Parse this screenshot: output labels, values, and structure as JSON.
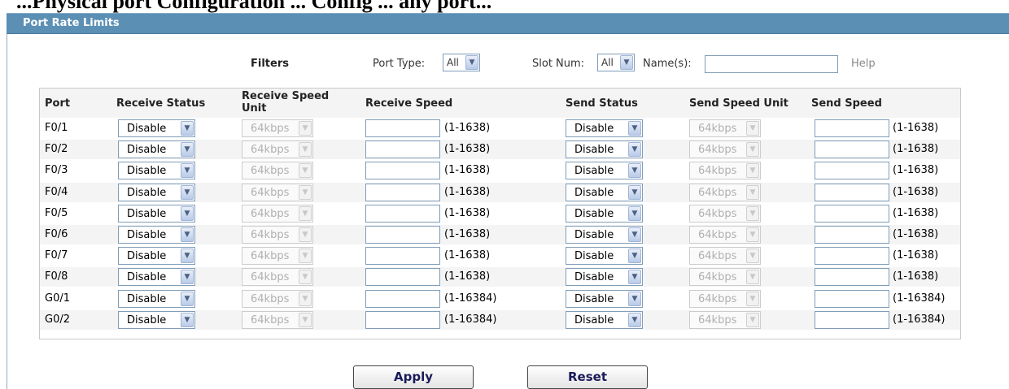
{
  "doc_heading": "...Physical port Configuration ... Config ... any port...",
  "panel_title": "Port Rate Limits",
  "filters": {
    "label": "Filters",
    "port_type_label": "Port Type:",
    "port_type_value": "All",
    "slot_num_label": "Slot Num:",
    "slot_num_value": "All",
    "names_label": "Name(s):",
    "names_value": "",
    "help_label": "Help"
  },
  "columns": {
    "port": "Port",
    "receive_status": "Receive Status",
    "receive_speed_unit": "Receive Speed Unit",
    "receive_speed": "Receive Speed",
    "send_status": "Send Status",
    "send_speed_unit": "Send Speed Unit",
    "send_speed": "Send Speed"
  },
  "rows": [
    {
      "port": "F0/1",
      "receive_status": "Disable",
      "receive_unit": "64kbps",
      "receive_speed": "",
      "receive_range": "(1-1638)",
      "send_status": "Disable",
      "send_unit": "64kbps",
      "send_speed": "",
      "send_range": "(1-1638)"
    },
    {
      "port": "F0/2",
      "receive_status": "Disable",
      "receive_unit": "64kbps",
      "receive_speed": "",
      "receive_range": "(1-1638)",
      "send_status": "Disable",
      "send_unit": "64kbps",
      "send_speed": "",
      "send_range": "(1-1638)"
    },
    {
      "port": "F0/3",
      "receive_status": "Disable",
      "receive_unit": "64kbps",
      "receive_speed": "",
      "receive_range": "(1-1638)",
      "send_status": "Disable",
      "send_unit": "64kbps",
      "send_speed": "",
      "send_range": "(1-1638)"
    },
    {
      "port": "F0/4",
      "receive_status": "Disable",
      "receive_unit": "64kbps",
      "receive_speed": "",
      "receive_range": "(1-1638)",
      "send_status": "Disable",
      "send_unit": "64kbps",
      "send_speed": "",
      "send_range": "(1-1638)"
    },
    {
      "port": "F0/5",
      "receive_status": "Disable",
      "receive_unit": "64kbps",
      "receive_speed": "",
      "receive_range": "(1-1638)",
      "send_status": "Disable",
      "send_unit": "64kbps",
      "send_speed": "",
      "send_range": "(1-1638)"
    },
    {
      "port": "F0/6",
      "receive_status": "Disable",
      "receive_unit": "64kbps",
      "receive_speed": "",
      "receive_range": "(1-1638)",
      "send_status": "Disable",
      "send_unit": "64kbps",
      "send_speed": "",
      "send_range": "(1-1638)"
    },
    {
      "port": "F0/7",
      "receive_status": "Disable",
      "receive_unit": "64kbps",
      "receive_speed": "",
      "receive_range": "(1-1638)",
      "send_status": "Disable",
      "send_unit": "64kbps",
      "send_speed": "",
      "send_range": "(1-1638)"
    },
    {
      "port": "F0/8",
      "receive_status": "Disable",
      "receive_unit": "64kbps",
      "receive_speed": "",
      "receive_range": "(1-1638)",
      "send_status": "Disable",
      "send_unit": "64kbps",
      "send_speed": "",
      "send_range": "(1-1638)"
    },
    {
      "port": "G0/1",
      "receive_status": "Disable",
      "receive_unit": "64kbps",
      "receive_speed": "",
      "receive_range": "(1-16384)",
      "send_status": "Disable",
      "send_unit": "64kbps",
      "send_speed": "",
      "send_range": "(1-16384)"
    },
    {
      "port": "G0/2",
      "receive_status": "Disable",
      "receive_unit": "64kbps",
      "receive_speed": "",
      "receive_range": "(1-16384)",
      "send_status": "Disable",
      "send_unit": "64kbps",
      "send_speed": "",
      "send_range": "(1-16384)"
    }
  ],
  "buttons": {
    "apply": "Apply",
    "reset": "Reset"
  },
  "colors": {
    "panel_header": "#5b8fb4",
    "row_stripe": "#f4f4f4",
    "button_text": "#1b1b5a"
  }
}
